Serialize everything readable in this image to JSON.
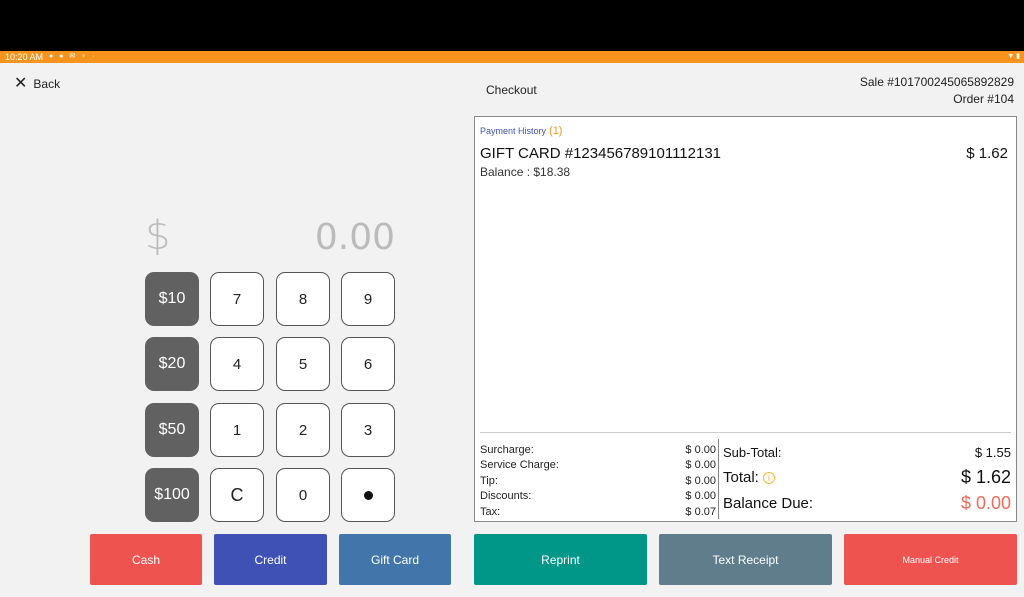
{
  "status_bar": {
    "time": "10:20 AM"
  },
  "header": {
    "back_label": "Back",
    "title": "Checkout",
    "sale_number": "Sale #101700245065892829",
    "order_number": "Order #104"
  },
  "keypad": {
    "currency_symbol": "$",
    "amount": "0.00",
    "keys": {
      "k10": "$10",
      "k20": "$20",
      "k50": "$50",
      "k100": "$100",
      "k7": "7",
      "k8": "8",
      "k9": "9",
      "k4": "4",
      "k5": "5",
      "k6": "6",
      "k1": "1",
      "k2": "2",
      "k3": "3",
      "kc": "C",
      "k0": "0"
    }
  },
  "payment_history": {
    "label": "Payment History",
    "count": "(1)",
    "item": {
      "name": "GIFT CARD #123456789101112131",
      "amount": "$ 1.62",
      "balance": "Balance : $18.38"
    }
  },
  "fees": {
    "surcharge_label": "Surcharge:",
    "surcharge": "$ 0.00",
    "service_label": "Service Charge:",
    "service": "$ 0.00",
    "tip_label": "Tip:",
    "tip": "$ 0.00",
    "discounts_label": "Discounts:",
    "discounts": "$ 0.00",
    "tax_label": "Tax:",
    "tax": "$ 0.07"
  },
  "totals": {
    "subtotal_label": "Sub-Total:",
    "subtotal": "$ 1.55",
    "total_label": "Total:",
    "total": "$ 1.62",
    "balance_due_label": "Balance Due:",
    "balance_due": "$ 0.00"
  },
  "buttons": {
    "cash": "Cash",
    "credit": "Credit",
    "gift_card": "Gift Card",
    "reprint": "Reprint",
    "text_receipt": "Text Receipt",
    "manual_credit": "Manual Credit"
  },
  "colors": {
    "status_bar": "#f7941d",
    "cash": "#ef5350",
    "credit": "#3f51b5",
    "gift_card": "#4276aa",
    "reprint": "#009688",
    "text_receipt": "#607d8b",
    "manual_credit": "#ef5350",
    "balance_due": "#ef6c5a"
  }
}
